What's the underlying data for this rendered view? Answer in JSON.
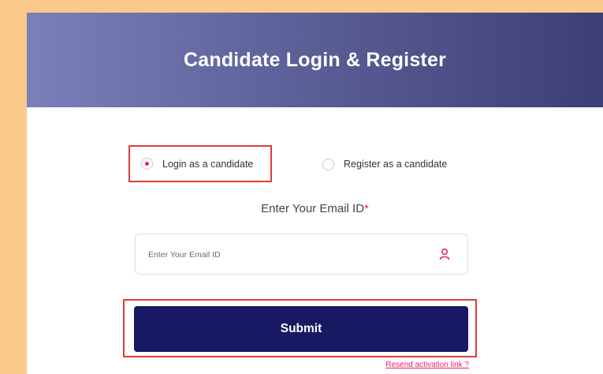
{
  "header": {
    "title": "Candidate Login & Register"
  },
  "mode_selector": {
    "options": [
      {
        "label": "Login as a candidate",
        "selected": true
      },
      {
        "label": "Register as a candidate",
        "selected": false
      }
    ]
  },
  "email": {
    "label": "Enter Your Email ID",
    "required_marker": "*",
    "placeholder": "Enter Your Email ID",
    "value": "",
    "icon": "user-icon"
  },
  "actions": {
    "submit_label": "Submit",
    "resend_link_label": "Resend activation link ?"
  },
  "colors": {
    "page_background": "#fcc98c",
    "header_gradient_start": "#7a80ba",
    "header_gradient_end": "#3b3f73",
    "accent": "#e6245b",
    "submit_background": "#171a62",
    "highlight_border": "#e23b3b"
  }
}
